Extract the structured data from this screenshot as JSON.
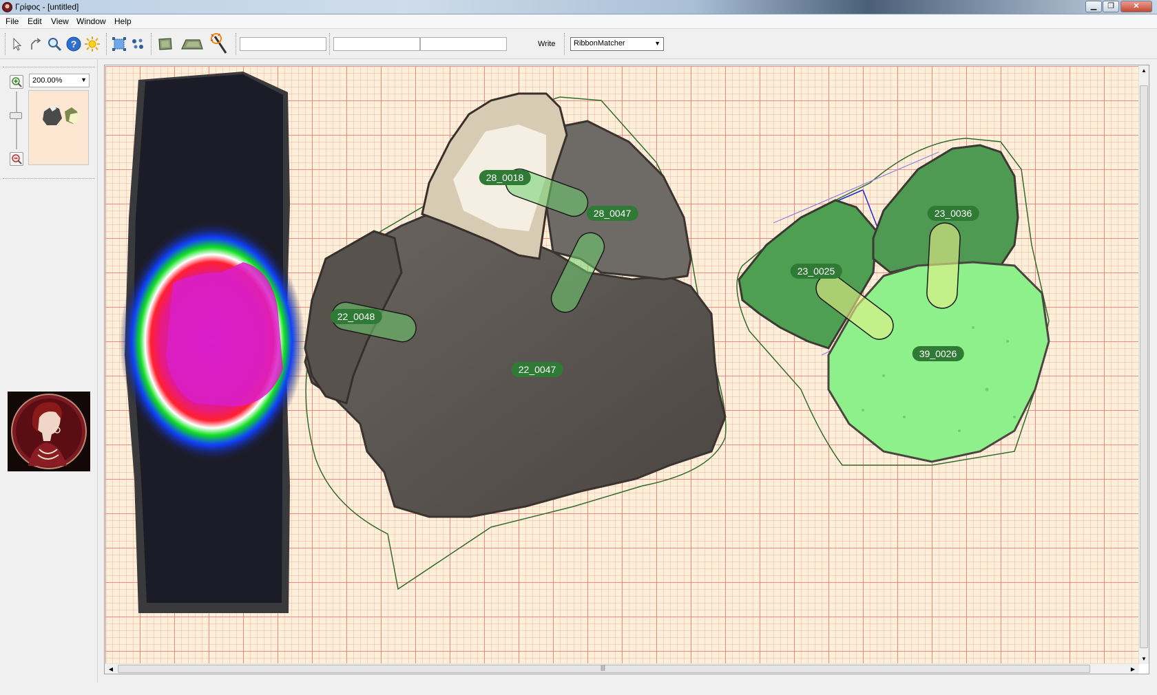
{
  "window": {
    "title": "Γρίφος - [untitled]",
    "minimize_glyph": "▁",
    "maximize_glyph": "❐",
    "close_glyph": "✕"
  },
  "menu": [
    "File",
    "Edit",
    "View",
    "Window",
    "Help"
  ],
  "toolbar": {
    "tools": [
      "select-arrow-icon",
      "rotate-arrow-icon",
      "magnifier-icon",
      "help-icon",
      "light-icon",
      "select-all-icon",
      "scatter-icon",
      "fragment-view-icon",
      "slab-view-icon",
      "magic-wand-icon"
    ],
    "input_1": "",
    "input_2": "",
    "input_3": "",
    "write_label": "Write",
    "matcher_value": "RibbonMatcher"
  },
  "left_panel": {
    "zoom_value": "200.00%"
  },
  "canvas": {
    "fragment_labels": [
      "28_0018",
      "28_0047",
      "22_0048",
      "22_0047",
      "23_0036",
      "23_0025",
      "39_0026"
    ],
    "colors": {
      "grid_background": "#fdefd9",
      "grid_lines": "#f06e6e",
      "label_fill": "#2f7a34",
      "hull_stroke": "#2e6b2e",
      "stone_dark": "#5a5550",
      "highlight_green": "#7fd67f"
    }
  }
}
